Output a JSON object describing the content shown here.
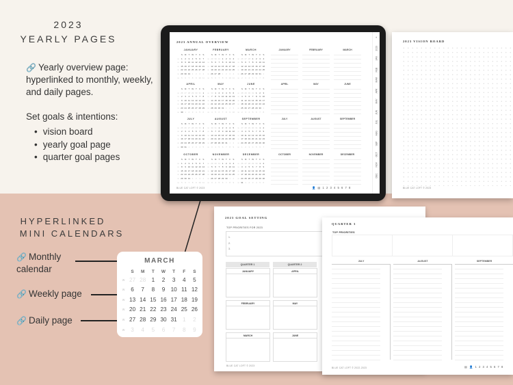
{
  "intro": {
    "year": "2023",
    "title": "YEARLY PAGES",
    "feature": "Yearly overview page: hyperlinked to monthly, weekly, and daily pages.",
    "goals_title": "Set goals & intentions:",
    "goals": [
      "vision board",
      "yearly goal page",
      "quarter goal pages"
    ]
  },
  "icons": {
    "link": "link-icon"
  },
  "calendars_section": {
    "title_line1": "HYPERLINKED",
    "title_line2": "MINI CALENDARS",
    "labels": [
      "Monthly calendar",
      "Weekly page",
      "Daily page"
    ]
  },
  "mini_calendar": {
    "month": "MARCH",
    "weekdays": [
      "S",
      "M",
      "T",
      "W",
      "T",
      "F",
      "S"
    ],
    "weeks": [
      {
        "wk": "w",
        "days": [
          "27",
          "28",
          "1",
          "2",
          "3",
          "4",
          "5"
        ],
        "faded": [
          0,
          1
        ]
      },
      {
        "wk": "w",
        "days": [
          "6",
          "7",
          "8",
          "9",
          "10",
          "11",
          "12"
        ],
        "faded": []
      },
      {
        "wk": "w",
        "days": [
          "13",
          "14",
          "15",
          "16",
          "17",
          "18",
          "19"
        ],
        "faded": []
      },
      {
        "wk": "w",
        "days": [
          "20",
          "21",
          "22",
          "23",
          "24",
          "25",
          "26"
        ],
        "faded": []
      },
      {
        "wk": "w",
        "days": [
          "27",
          "28",
          "29",
          "30",
          "31",
          "1",
          "2"
        ],
        "faded": [
          5,
          6
        ]
      },
      {
        "wk": "w",
        "days": [
          "3",
          "4",
          "5",
          "6",
          "7",
          "8",
          "9"
        ],
        "faded": [
          0,
          1,
          2,
          3,
          4,
          5,
          6
        ]
      }
    ]
  },
  "tablet": {
    "title": "2023 ANNUAL OVERVIEW",
    "year": 2023,
    "months": [
      "JANUARY",
      "FEBRUARY",
      "MARCH",
      "APRIL",
      "MAY",
      "JUNE",
      "JULY",
      "AUGUST",
      "SEPTEMBER",
      "OCTOBER",
      "NOVEMBER",
      "DECEMBER"
    ],
    "weekday_letters": [
      "S",
      "M",
      "T",
      "W",
      "T",
      "F",
      "S"
    ],
    "side_tabs": [
      "2023",
      "JAN",
      "FEB",
      "MAR",
      "APR",
      "MAY",
      "JUN",
      "JUL",
      "AUG",
      "SEP",
      "OCT",
      "NOV",
      "DEC"
    ],
    "footer": "BLUE CAT LOFT © 2023",
    "pager": "1 2 3 4 5 6 7 8"
  },
  "vision_board": {
    "title": "2023 VISION BOARD",
    "footer": "BLUE CAT LOFT © 2023"
  },
  "goal_setting": {
    "title": "2023 GOAL SETTING",
    "priorities_label": "TOP PRIORITIES FOR 2023",
    "priority_numbers": [
      "1.",
      "2.",
      "3."
    ],
    "quarters": [
      "QUARTER 1",
      "QUARTER 2"
    ],
    "months": [
      [
        "JANUARY",
        "FEBRUARY",
        "MARCH"
      ],
      [
        "APRIL",
        "MAY",
        "JUNE"
      ]
    ],
    "footer": "BLUE CAT LOFT © 2023"
  },
  "quarter_page": {
    "title": "QUARTER 3",
    "priorities_label": "TOP PRIORITIES",
    "months": [
      "JULY",
      "AUGUST",
      "SEPTEMBER"
    ],
    "footer": "BLUE CAT LOFT © 2022-2023",
    "pager": "1 2 3 4 5 6 7 8"
  }
}
